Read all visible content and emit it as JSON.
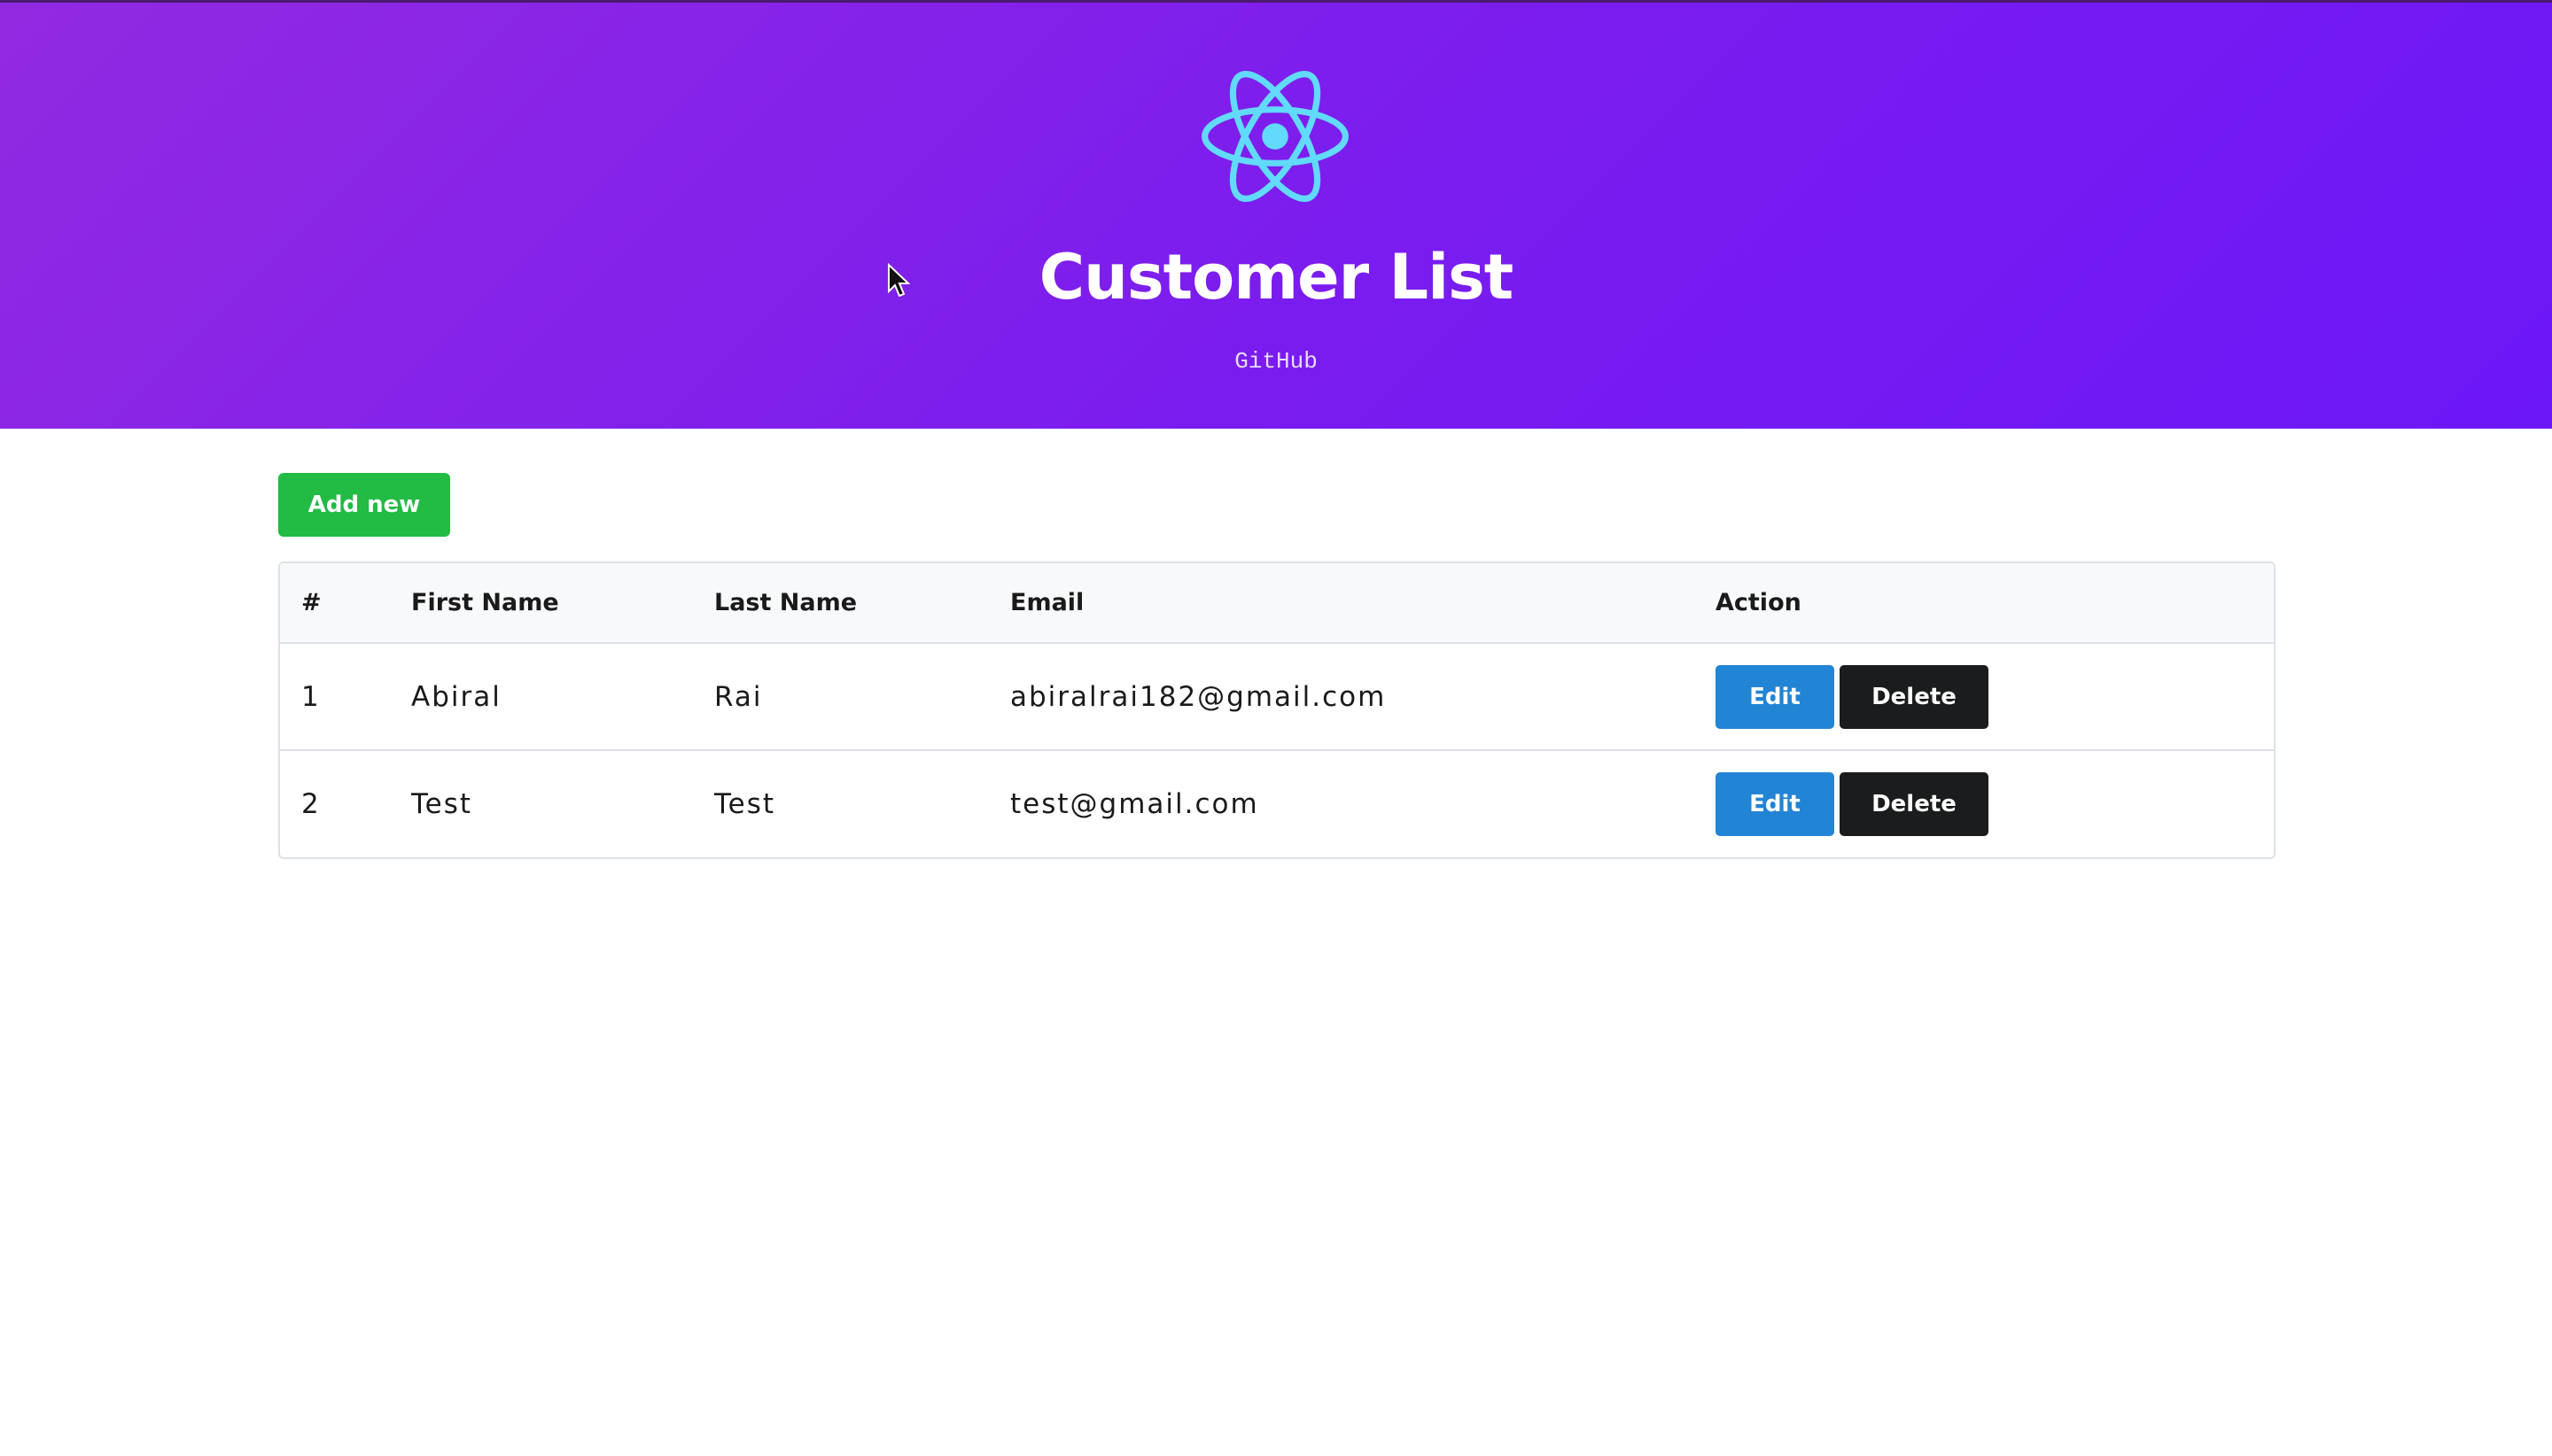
{
  "header": {
    "title": "Customer List",
    "link_label": "GitHub",
    "logo_icon": "react-atom-icon",
    "logo_color": "#61dafb",
    "gradient_start": "#922ae1",
    "gradient_end": "#6c17f7"
  },
  "toolbar": {
    "add_label": "Add new",
    "add_color": "#22bb44"
  },
  "table": {
    "columns": [
      "#",
      "First Name",
      "Last Name",
      "Email",
      "Action"
    ],
    "rows": [
      {
        "id": "1",
        "first_name": "Abiral",
        "last_name": "Rai",
        "email": "abiralrai182@gmail.com",
        "edit_label": "Edit",
        "delete_label": "Delete"
      },
      {
        "id": "2",
        "first_name": "Test",
        "last_name": "Test",
        "email": "test@gmail.com",
        "edit_label": "Edit",
        "delete_label": "Delete"
      }
    ],
    "edit_color": "#2284d4",
    "delete_color": "#1b1c1d"
  }
}
